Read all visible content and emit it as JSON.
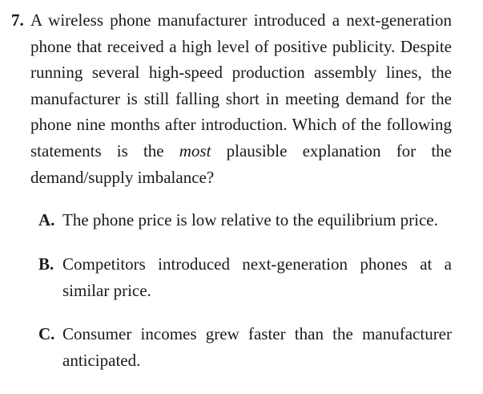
{
  "question": {
    "number": "7.",
    "stem_before_emphasis": "A wireless phone manufacturer introduced a next-generation phone that received a high level of positive publicity. Despite running several high-speed production assembly lines, the manufacturer is still falling short in meeting demand for the phone nine months after introduction. Which of the following statements is the ",
    "stem_emphasis": "most",
    "stem_after_emphasis": " plausible explanation for the demand/supply imbalance?"
  },
  "choices": [
    {
      "letter": "A.",
      "text": "The phone price is low relative to the equilibrium price."
    },
    {
      "letter": "B.",
      "text": "Competitors introduced next-generation phones at a similar price."
    },
    {
      "letter": "C.",
      "text": "Consumer incomes grew faster than the manufacturer anticipated."
    }
  ]
}
